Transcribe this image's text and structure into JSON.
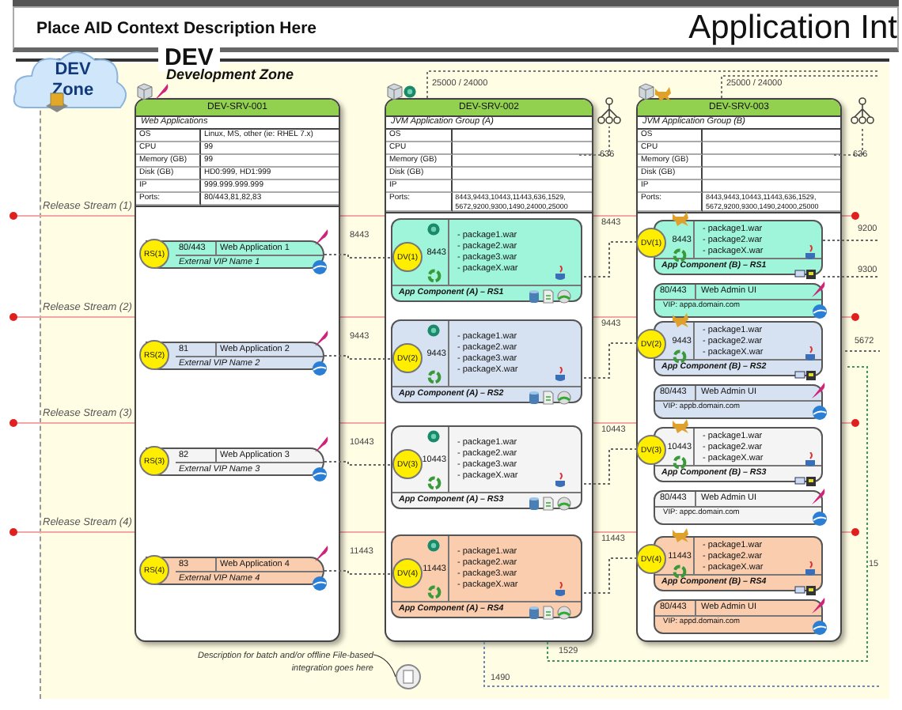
{
  "header": {
    "context": "Place AID Context Description Here",
    "title": "Application Int"
  },
  "zone": {
    "name": "DEV",
    "subtitle": "Development Zone",
    "cloud_label": "DEV Zone"
  },
  "release_streams": [
    "Release Stream (1)",
    "Release Stream (2)",
    "Release Stream (3)",
    "Release Stream (4)"
  ],
  "servers": [
    {
      "name": "DEV-SRV-001",
      "group": "Web Applications",
      "specs": [
        {
          "label": "OS",
          "value": "Linux, MS, other (ie: RHEL 7.x)"
        },
        {
          "label": "CPU",
          "value": "99"
        },
        {
          "label": "Memory (GB)",
          "value": "99"
        },
        {
          "label": "Disk (GB)",
          "value": "HD0:999, HD1:999"
        },
        {
          "label": "IP",
          "value": "999.999.999.999"
        },
        {
          "label": "Ports:",
          "value": "80/443,81,82,83"
        }
      ]
    },
    {
      "name": "DEV-SRV-002",
      "group": "JVM Application Group (A)",
      "specs": [
        {
          "label": "OS"
        },
        {
          "label": "CPU"
        },
        {
          "label": "Memory (GB)"
        },
        {
          "label": "Disk (GB)"
        },
        {
          "label": "IP"
        },
        {
          "label": "Ports:",
          "value": "8443,9443,10443,11443,636,1529, 5672,9200,9300,1490,24000,25000"
        }
      ]
    },
    {
      "name": "DEV-SRV-003",
      "group": "JVM Application Group (B)",
      "specs": [
        {
          "label": "OS"
        },
        {
          "label": "CPU"
        },
        {
          "label": "Memory (GB)"
        },
        {
          "label": "Disk (GB)"
        },
        {
          "label": "IP"
        },
        {
          "label": "Ports:",
          "value": "8443,9443,10443,11443,636,1529, 5672,9200,9300,1490,24000,25000"
        }
      ]
    }
  ],
  "load_balancers": [
    {
      "ports": "25000 / 24000",
      "ldap_port": "636"
    },
    {
      "ports": "25000 / 24000",
      "ldap_port": "636"
    }
  ],
  "web_apps": [
    {
      "badge": "RS(1)",
      "port": "80/443",
      "name": "Web Application 1",
      "vip": "External VIP Name 1",
      "color": "#9ef5da",
      "link_port": "8443"
    },
    {
      "badge": "RS(2)",
      "port": "81",
      "name": "Web Application 2",
      "vip": "External VIP Name 2",
      "color": "#d6e1f1",
      "link_port": "9443"
    },
    {
      "badge": "RS(3)",
      "port": "82",
      "name": "Web Application 3",
      "vip": "External VIP Name 3",
      "color": "#f4f4f4",
      "link_port": "10443"
    },
    {
      "badge": "RS(4)",
      "port": "83",
      "name": "Web Application 4",
      "vip": "External VIP Name 4",
      "color": "#f9cdae",
      "link_port": "11443"
    }
  ],
  "components_a": [
    {
      "badge": "DV(1)",
      "port": "8443",
      "packages": [
        "- package1.war",
        "- package2.war",
        "- package3.war",
        "- packageX.war"
      ],
      "label": "App Component (A) – RS1",
      "color": "#9ef5da"
    },
    {
      "badge": "DV(2)",
      "port": "9443",
      "packages": [
        "- package1.war",
        "- package2.war",
        "- package3.war",
        "- packageX.war"
      ],
      "label": "App Component (A) – RS2",
      "color": "#d6e1f1"
    },
    {
      "badge": "DV(3)",
      "port": "10443",
      "packages": [
        "- package1.war",
        "- package2.war",
        "- package3.war",
        "- packageX.war"
      ],
      "label": "App Component (A) – RS3",
      "color": "#f4f4f4"
    },
    {
      "badge": "DV(4)",
      "port": "11443",
      "packages": [
        "- package1.war",
        "- package2.war",
        "- package3.war",
        "- packageX.war"
      ],
      "label": "App Component (A) – RS4",
      "color": "#f9cdae"
    }
  ],
  "components_b": [
    {
      "badge": "DV(1)",
      "port": "8443",
      "link_port": "8443",
      "packages": [
        "- package1.war",
        "- package2.war",
        "- packageX.war"
      ],
      "label": "App Component (B) – RS1",
      "color": "#9ef5da",
      "admin": {
        "port": "80/443",
        "name": "Web Admin UI",
        "vip": "VIP: appa.domain.com"
      }
    },
    {
      "badge": "DV(2)",
      "port": "9443",
      "link_port": "9443",
      "packages": [
        "- package1.war",
        "- package2.war",
        "- packageX.war"
      ],
      "label": "App Component (B) – RS2",
      "color": "#d6e1f1",
      "admin": {
        "port": "80/443",
        "name": "Web Admin UI",
        "vip": "VIP: appb.domain.com"
      }
    },
    {
      "badge": "DV(3)",
      "port": "10443",
      "link_port": "10443",
      "packages": [
        "- package1.war",
        "- package2.war",
        "- packageX.war"
      ],
      "label": "App Component (B) – RS3",
      "color": "#f4f4f4",
      "admin": {
        "port": "80/443",
        "name": "Web Admin UI",
        "vip": "VIP: appc.domain.com"
      }
    },
    {
      "badge": "DV(4)",
      "port": "11443",
      "link_port": "11443",
      "packages": [
        "- package1.war",
        "- package2.war",
        "- packageX.war"
      ],
      "label": "App Component (B) – RS4",
      "color": "#f9cdae",
      "admin": {
        "port": "80/443",
        "name": "Web Admin UI",
        "vip": "VIP: appd.domain.com"
      }
    }
  ],
  "side_ports": [
    "9200",
    "9300",
    "5672",
    "15"
  ],
  "bottom_ports": [
    "1529",
    "1490"
  ],
  "batch_note": "Description for batch and/or offline File-based integration goes here"
}
